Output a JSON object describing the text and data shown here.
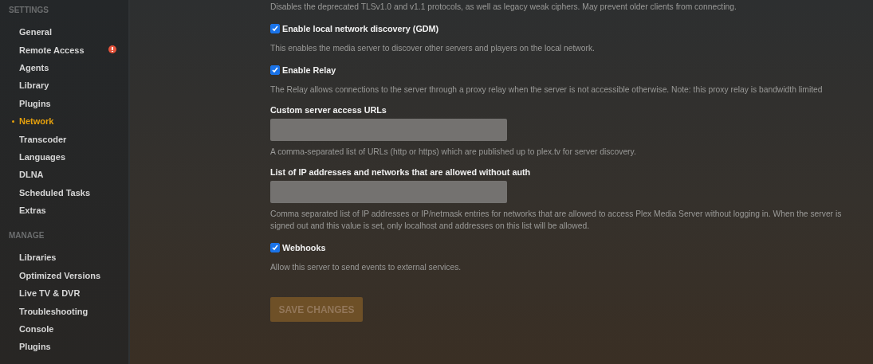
{
  "sidebar": {
    "sections": [
      {
        "heading": "SETTINGS",
        "items": [
          {
            "label": "General",
            "selected": false,
            "alert": false
          },
          {
            "label": "Remote Access",
            "selected": false,
            "alert": true
          },
          {
            "label": "Agents",
            "selected": false,
            "alert": false
          },
          {
            "label": "Library",
            "selected": false,
            "alert": false
          },
          {
            "label": "Plugins",
            "selected": false,
            "alert": false
          },
          {
            "label": "Network",
            "selected": true,
            "alert": false
          },
          {
            "label": "Transcoder",
            "selected": false,
            "alert": false
          },
          {
            "label": "Languages",
            "selected": false,
            "alert": false
          },
          {
            "label": "DLNA",
            "selected": false,
            "alert": false
          },
          {
            "label": "Scheduled Tasks",
            "selected": false,
            "alert": false
          },
          {
            "label": "Extras",
            "selected": false,
            "alert": false
          }
        ]
      },
      {
        "heading": "MANAGE",
        "items": [
          {
            "label": "Libraries",
            "selected": false,
            "alert": false
          },
          {
            "label": "Optimized Versions",
            "selected": false,
            "alert": false
          },
          {
            "label": "Live TV & DVR",
            "selected": false,
            "alert": false
          },
          {
            "label": "Troubleshooting",
            "selected": false,
            "alert": false
          },
          {
            "label": "Console",
            "selected": false,
            "alert": false
          },
          {
            "label": "Plugins",
            "selected": false,
            "alert": false
          }
        ]
      }
    ]
  },
  "settings": [
    {
      "kind": "note",
      "description": "Disables the deprecated TLSv1.0 and v1.1 protocols, as well as legacy weak ciphers. May prevent older clients from connecting."
    },
    {
      "kind": "checkbox",
      "label": "Enable local network discovery (GDM)",
      "checked": true,
      "description": "This enables the media server to discover other servers and players on the local network."
    },
    {
      "kind": "checkbox",
      "label": "Enable Relay",
      "checked": true,
      "description": "The Relay allows connections to the server through a proxy relay when the server is not accessible otherwise. Note: this proxy relay is bandwidth limited"
    },
    {
      "kind": "field",
      "label": "Custom server access URLs",
      "description": "A comma-separated list of URLs (http or https) which are published up to plex.tv for server discovery."
    },
    {
      "kind": "field",
      "label": "List of IP addresses and networks that are allowed without auth",
      "description": "Comma separated list of IP addresses or IP/netmask entries for networks that are allowed to access Plex Media Server without logging in. When the server is signed out and this value is set, only localhost and addresses on this list will be allowed."
    },
    {
      "kind": "checkbox",
      "label": "Webhooks",
      "checked": true,
      "description": "Allow this server to send events to external services."
    }
  ],
  "save_button": {
    "label": "SAVE CHANGES",
    "disabled": true
  }
}
